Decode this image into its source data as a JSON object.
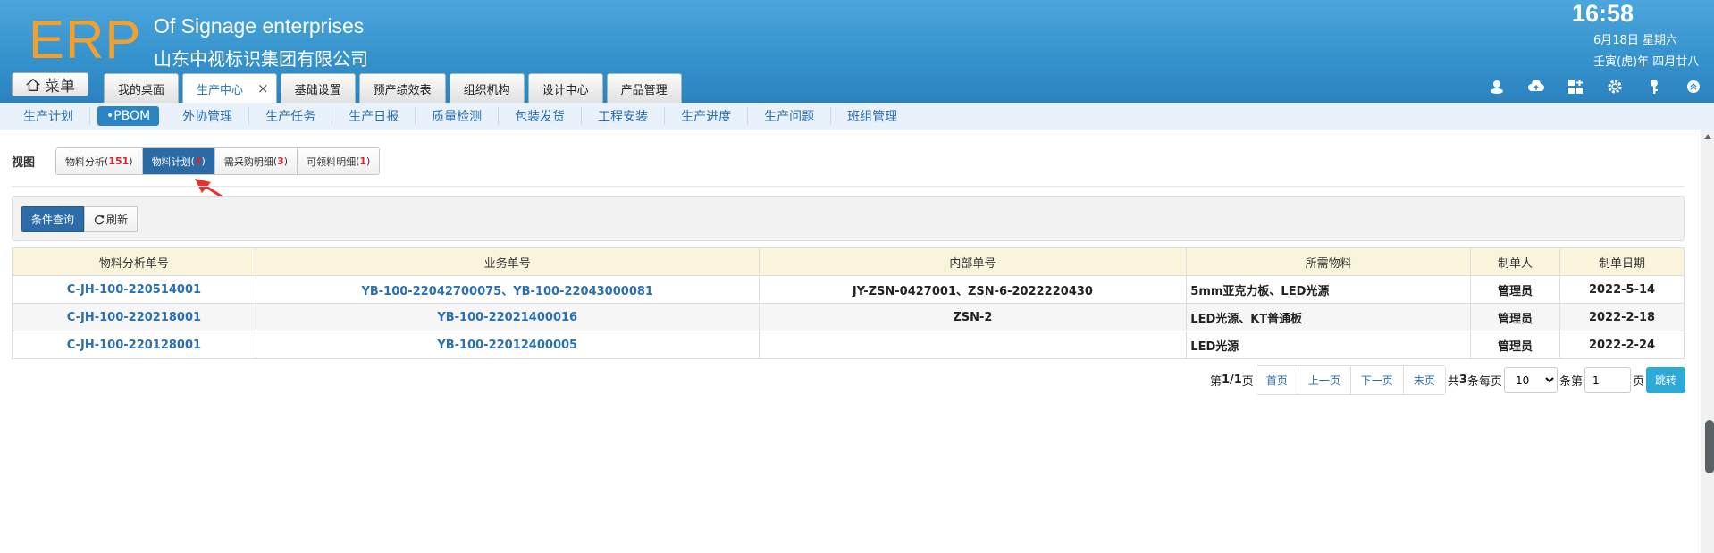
{
  "header": {
    "logo": "ERP",
    "company_en": "Of Signage enterprises",
    "company_cn": "山东中视标识集团有限公司",
    "time": "16:58",
    "date": "6月18日 星期六",
    "lunar": "壬寅(虎)年 四月廿八",
    "menu_label": "菜单"
  },
  "top_tabs": [
    {
      "label": "我的桌面"
    },
    {
      "label": "生产中心",
      "close": "×"
    },
    {
      "label": "基础设置"
    },
    {
      "label": "预产绩效表"
    },
    {
      "label": "组织机构"
    },
    {
      "label": "设计中心"
    },
    {
      "label": "产品管理"
    }
  ],
  "header_icons": [
    "user-icon",
    "cloud-upload-icon",
    "grid-add-icon",
    "gear-icon",
    "key-icon",
    "collapse-up-icon"
  ],
  "subnav": [
    "生产计划",
    "•PBOM",
    "外协管理",
    "生产任务",
    "生产日报",
    "质量检测",
    "包装发货",
    "工程安装",
    "生产进度",
    "生产问题",
    "班组管理"
  ],
  "view": {
    "label": "视图",
    "tabs": [
      {
        "name": "物料分析",
        "count": "151"
      },
      {
        "name": "物料计划",
        "count": "3"
      },
      {
        "name": "需采购明细",
        "count": "3"
      },
      {
        "name": "可领料明细",
        "count": "1"
      }
    ]
  },
  "toolbar": {
    "query": "条件查询",
    "refresh": "刷新"
  },
  "table": {
    "headers": [
      "物料分析单号",
      "业务单号",
      "内部单号",
      "所需物料",
      "制单人",
      "制单日期"
    ],
    "rows": [
      [
        "C-JH-100-220514001",
        "YB-100-22042700075、YB-100-22043000081",
        "JY-ZSN-0427001、ZSN-6-2022220430",
        "5mm亚克力板、LED光源",
        "管理员",
        "2022-5-14"
      ],
      [
        "C-JH-100-220218001",
        "YB-100-22021400016",
        "ZSN-2",
        "LED光源、KT普通板",
        "管理员",
        "2022-2-18"
      ],
      [
        "C-JH-100-220128001",
        "YB-100-22012400005",
        "",
        "LED光源",
        "管理员",
        "2022-2-24"
      ]
    ]
  },
  "pager": {
    "page_prefix": "第",
    "page_info": "1/1",
    "page_suffix": "页",
    "first": "首页",
    "prev": "上一页",
    "next": "下一页",
    "last": "末页",
    "total_prefix": "共",
    "total": "3",
    "total_suffix": "条每页",
    "page_size": "10",
    "goto_prefix": "条第",
    "goto_value": "1",
    "goto_suffix": "页",
    "jump": "跳转"
  }
}
